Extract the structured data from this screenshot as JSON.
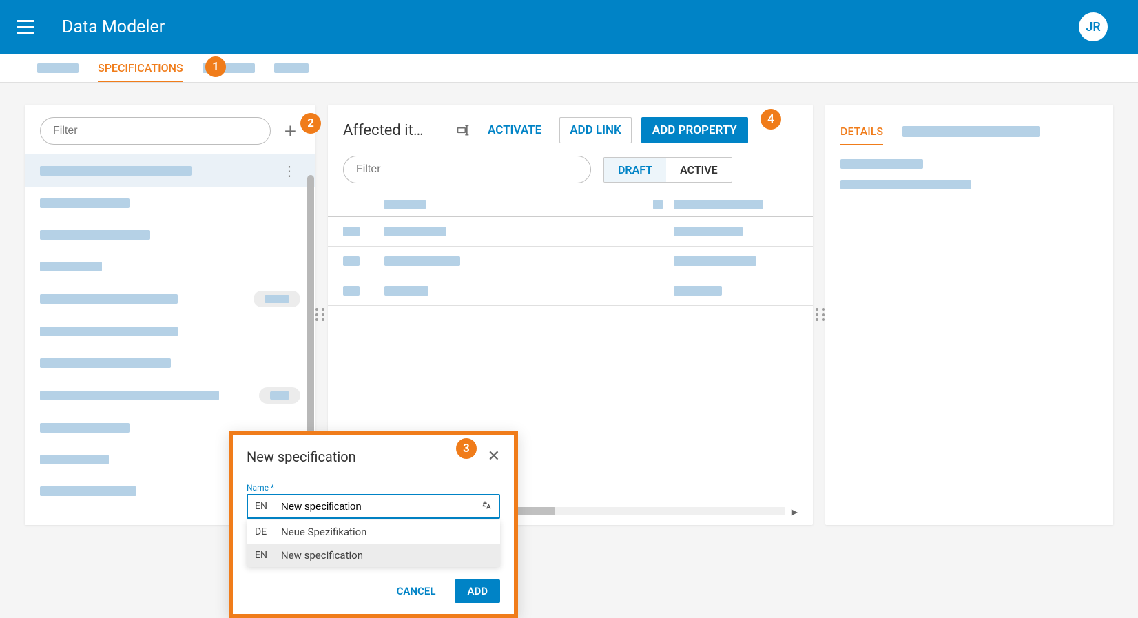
{
  "header": {
    "app_title": "Data Modeler",
    "avatar_initials": "JR"
  },
  "tabs": {
    "active_label": "SPECIFICATIONS"
  },
  "left_panel": {
    "filter_placeholder": "Filter"
  },
  "mid_panel": {
    "title": "Affected it…",
    "activate_label": "ACTIVATE",
    "add_link_label": "ADD LINK",
    "add_property_label": "ADD PROPERTY",
    "filter_placeholder": "Filter",
    "draft_label": "DRAFT",
    "active_label": "ACTIVE"
  },
  "right_panel": {
    "details_label": "DETAILS"
  },
  "dialog": {
    "title": "New specification",
    "field_label": "Name *",
    "input_lang": "EN",
    "input_value": "New specification",
    "options": [
      {
        "lang": "DE",
        "text": "Neue Spezifikation"
      },
      {
        "lang": "EN",
        "text": "New specification"
      }
    ],
    "cancel_label": "CANCEL",
    "add_label": "ADD"
  },
  "callouts": {
    "c1": "1",
    "c2": "2",
    "c3": "3",
    "c4": "4"
  }
}
